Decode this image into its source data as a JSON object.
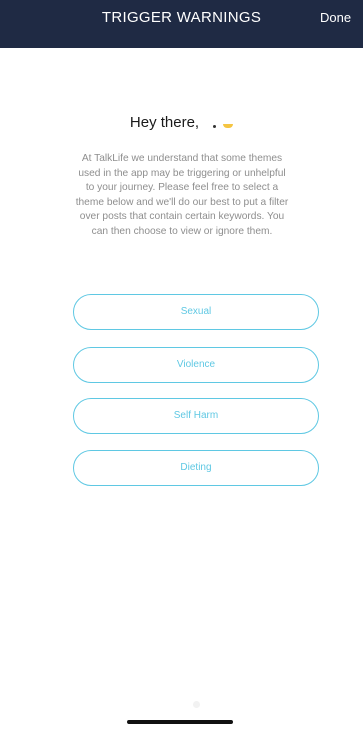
{
  "header": {
    "title": "TRIGGER WARNINGS",
    "done_label": "Done",
    "background_color": "#1f2a44"
  },
  "main": {
    "greeting": "Hey there,",
    "intro": "At TalkLife we understand that some themes used in the app may be triggering or unhelpful to your journey. Please feel free to select a theme below and we'll do our best to put a filter over posts that contain certain keywords. You can then choose to view or ignore them.",
    "themes": [
      {
        "label": "Sexual"
      },
      {
        "label": "Violence"
      },
      {
        "label": "Self Harm"
      },
      {
        "label": "Dieting"
      }
    ],
    "accent_color": "#5fc8e3"
  }
}
